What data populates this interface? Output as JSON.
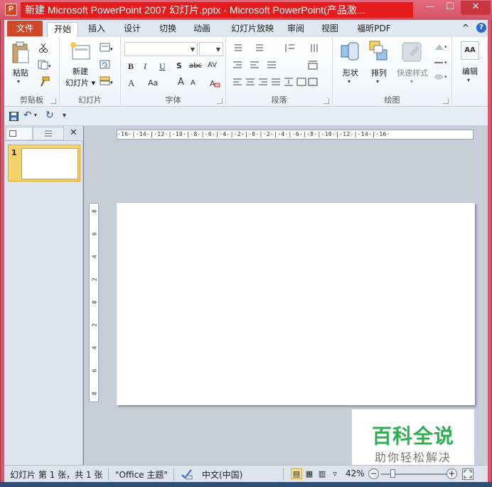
{
  "window": {
    "title": "新建 Microsoft PowerPoint 2007 幻灯片.pptx - Microsoft PowerPoint(产品激...",
    "app_letter": "P",
    "minimize": "—",
    "maximize": "☐",
    "close": "✕"
  },
  "tabs": [
    {
      "label": "文件"
    },
    {
      "label": "开始"
    },
    {
      "label": "插入"
    },
    {
      "label": "设计"
    },
    {
      "label": "切换"
    },
    {
      "label": "动画"
    },
    {
      "label": "幻灯片放映"
    },
    {
      "label": "审阅"
    },
    {
      "label": "视图"
    },
    {
      "label": "福昕PDF"
    }
  ],
  "help": "?",
  "collapse": "^",
  "ribbon": {
    "clipboard": {
      "paste": "粘贴",
      "group": "剪贴板"
    },
    "slides": {
      "new_slide_line1": "新建",
      "new_slide_line2": "幻灯片 ▾",
      "group": "幻灯片"
    },
    "font": {
      "bold": "B",
      "italic": "I",
      "underline": "U",
      "shadow": "S",
      "strike": "abc",
      "spacing": "AV",
      "color": "A",
      "case": "Aa",
      "grow": "A",
      "shrink": "A",
      "group": "字体"
    },
    "paragraph": {
      "group": "段落"
    },
    "drawing": {
      "shapes": "形状",
      "arrange": "排列",
      "quick_styles": "快速样式",
      "group": "绘图"
    },
    "editing": {
      "label": "编辑",
      "icon_text": "AA"
    }
  },
  "qat": {
    "save": "save",
    "undo": "↶",
    "redo": "↻",
    "customize": "▾"
  },
  "slide_pane": {
    "close": "✕",
    "slide_number": "1"
  },
  "ruler": {
    "horizontal": "·16·|·14·|·12·|·10·|·8·|·6·|·4·|·2·|·0·|·2·|·4·|·6·|·8·|·10·|·12·|·14·|·16·",
    "vertical": [
      "8",
      "6",
      "4",
      "2",
      "0",
      "2",
      "4",
      "6",
      "8"
    ]
  },
  "watermark": {
    "title": "百科全说",
    "subtitle": "助你轻松解决"
  },
  "status": {
    "slide_info": "幻灯片 第 1 张，共 1 张",
    "theme": "\"Office 主题\"",
    "language": "中文(中国)",
    "zoom": "42%",
    "zoom_out": "−",
    "zoom_in": "+"
  },
  "colors": {
    "accent": "#d24726",
    "title_highlight": "#e41c1c",
    "watermark_green": "#2fae52"
  }
}
